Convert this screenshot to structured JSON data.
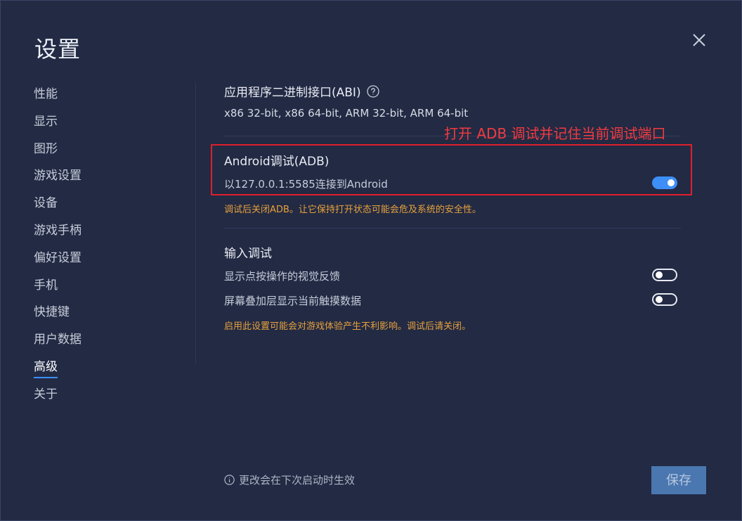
{
  "window": {
    "title": "设置"
  },
  "sidebar": {
    "items": [
      {
        "label": "性能"
      },
      {
        "label": "显示"
      },
      {
        "label": "图形"
      },
      {
        "label": "游戏设置"
      },
      {
        "label": "设备"
      },
      {
        "label": "游戏手柄"
      },
      {
        "label": "偏好设置"
      },
      {
        "label": "手机"
      },
      {
        "label": "快捷键"
      },
      {
        "label": "用户数据"
      },
      {
        "label": "高级"
      },
      {
        "label": "关于"
      }
    ],
    "active": "高级"
  },
  "abi": {
    "title": "应用程序二进制接口(ABI)",
    "value": "x86 32-bit, x86 64-bit, ARM 32-bit, ARM 64-bit"
  },
  "annotation": {
    "text": "打开 ADB 调试并记住当前调试端口"
  },
  "adb": {
    "title": "Android调试(ADB)",
    "label": "以127.0.0.1:5585连接到Android",
    "enabled": true,
    "warning": "调试后关闭ADB。让它保持打开状态可能会危及系统的安全性。"
  },
  "input_debug": {
    "title": "输入调试",
    "options": [
      {
        "label": "显示点按操作的视觉反馈",
        "enabled": false
      },
      {
        "label": "屏幕叠加层显示当前触摸数据",
        "enabled": false
      }
    ],
    "warning": "启用此设置可能会对游戏体验产生不利影响。调试后请关闭。"
  },
  "footer": {
    "note": "更改会在下次启动时生效",
    "save_label": "保存"
  },
  "colors": {
    "accent": "#3d8ff7",
    "warning": "#e8a13c",
    "annotation": "#f23b3f",
    "background": "#222a44"
  }
}
